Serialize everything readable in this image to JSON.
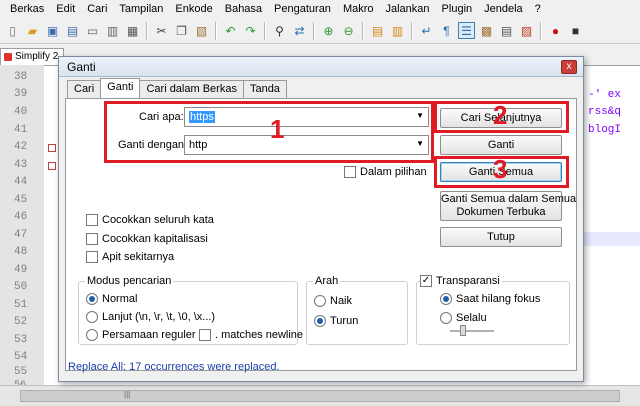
{
  "menu": [
    "Berkas",
    "Edit",
    "Cari",
    "Tampilan",
    "Enkode",
    "Bahasa",
    "Pengaturan",
    "Makro",
    "Jalankan",
    "Plugin",
    "Jendela",
    "?"
  ],
  "toolbar_icons": [
    "new-file-icon",
    "open-file-icon",
    "save-icon",
    "save-all-icon",
    "close-icon",
    "close-all-icon",
    "print-icon",
    "cut-icon",
    "copy-icon",
    "paste-icon",
    "undo-icon",
    "redo-icon",
    "find-icon",
    "replace-icon",
    "zoom-in-icon",
    "zoom-out-icon",
    "sync-v-icon",
    "sync-h-icon",
    "wrap-icon",
    "all-chars-icon",
    "indent-guide-icon",
    "doc-map-icon",
    "function-list-icon",
    "folder-workspace-icon",
    "record-macro-icon",
    "stop-macro-icon"
  ],
  "doc_tab": {
    "label": "Simplify 2"
  },
  "line_numbers": [
    "38",
    "39",
    "40",
    "41",
    "42",
    "43",
    "44",
    "45",
    "46",
    "47",
    "48",
    "49",
    "50",
    "51",
    "52",
    "53",
    "54",
    "55",
    "56"
  ],
  "code_fragments": {
    "l39": "-' ex",
    "l40": "rss&q",
    "l41": "blogI"
  },
  "dialog": {
    "title": "Ganti",
    "close_glyph": "x",
    "tabs": [
      "Cari",
      "Ganti",
      "Cari dalam Berkas",
      "Tanda"
    ],
    "find_label": "Cari apa:",
    "find_value": "https",
    "replace_label": "Ganti dengan:",
    "replace_value": "http",
    "in_selection": "Dalam pilihan",
    "options": [
      "Cocokkan seluruh kata",
      "Cocokkan kapitalisasi",
      "Apit sekitarnya"
    ],
    "search_mode": {
      "title": "Modus pencarian",
      "normal": "Normal",
      "extended": "Lanjut (\\n, \\r, \\t, \\0, \\x...)",
      "regex": "Persamaan reguler",
      "matches_newline": ". matches newline",
      "selected": "Normal"
    },
    "direction": {
      "title": "Arah",
      "up": "Naik",
      "down": "Turun",
      "selected": "Turun"
    },
    "transparency": {
      "title": "Transparansi",
      "checked": true,
      "on_lose_focus": "Saat hilang fokus",
      "always": "Selalu",
      "selected": "Saat hilang fokus",
      "check_glyph": "✓"
    },
    "buttons": {
      "find_next": "Cari Selanjutnya",
      "replace": "Ganti",
      "replace_all": "Ganti Semua",
      "replace_all_open_1": "Ganti Semua dalam Semua",
      "replace_all_open_2": "Dokumen Terbuka",
      "close": "Tutup"
    },
    "status": "Replace All: 17 occurrences were replaced."
  },
  "annotations": [
    "1",
    "2",
    "3"
  ],
  "colors": {
    "annotation": "#e01b24",
    "status_text": "#1a3fa8",
    "selection": "#3399ff"
  }
}
